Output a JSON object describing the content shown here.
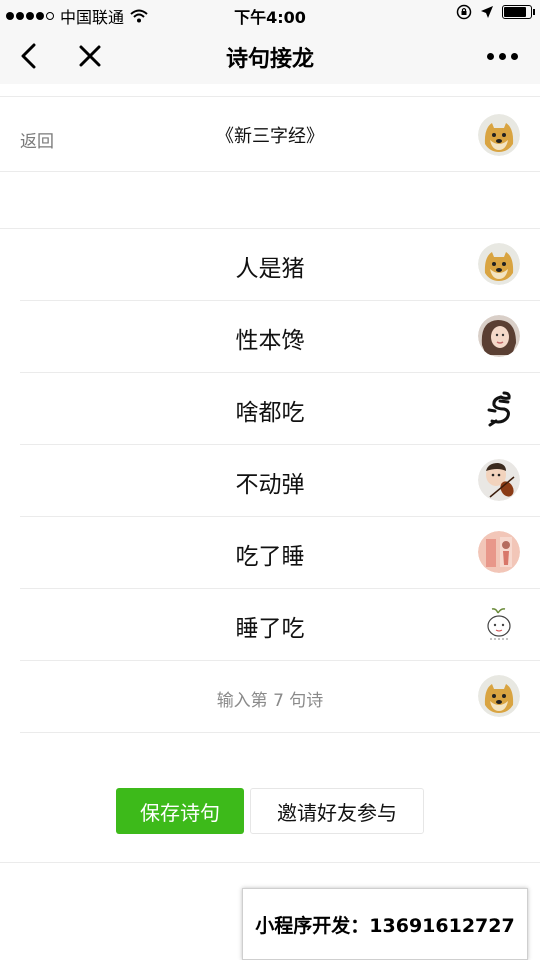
{
  "status_bar": {
    "carrier": "中国联通",
    "time": "下午4:00",
    "battery_level": 0.85
  },
  "nav": {
    "title": "诗句接龙"
  },
  "poem": {
    "back_label": "返回",
    "title": "《新三字经》"
  },
  "lines": [
    {
      "text": "人是猪",
      "avatar": "doge-avatar"
    },
    {
      "text": "性本馋",
      "avatar": "girl-avatar"
    },
    {
      "text": "啥都吃",
      "avatar": "dragon-avatar"
    },
    {
      "text": "不动弹",
      "avatar": "child-violin-avatar"
    },
    {
      "text": "吃了睡",
      "avatar": "illustration-avatar"
    },
    {
      "text": "睡了吃",
      "avatar": "sketch-avatar"
    }
  ],
  "input_row": {
    "placeholder": "输入第 7 句诗"
  },
  "buttons": {
    "save_label": "保存诗句",
    "invite_label": "邀请好友参与"
  },
  "promo": {
    "text": "小程序开发：13691612727"
  },
  "colors": {
    "accent_green": "#3dba1a",
    "nav_bg": "#f7f7f7"
  }
}
